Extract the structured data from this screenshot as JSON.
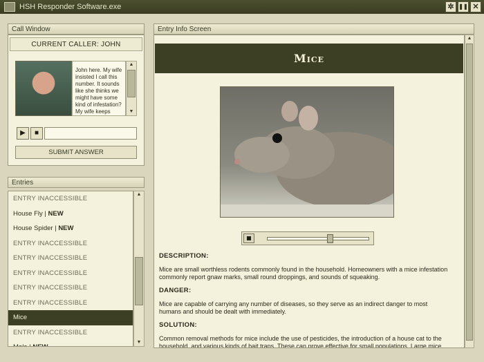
{
  "window": {
    "title": "HSH Responder Software.exe"
  },
  "window_buttons": [
    {
      "name": "settings-button",
      "glyph": "✲"
    },
    {
      "name": "pause-button",
      "glyph": "❚❚"
    },
    {
      "name": "close-button",
      "glyph": "✕"
    }
  ],
  "call_window": {
    "header": "Call Window",
    "current_caller": "CURRENT CALLER: JOHN",
    "transcript": "John here. My wife insisted I call this number. It sounds like she thinks we might have some kind of infestation? My wife keeps telling me about sounds of distr",
    "answer_value": "",
    "submit_label": "SUBMIT ANSWER"
  },
  "entries": {
    "header": "Entries",
    "items": [
      {
        "label": "ENTRY INACCESSIBLE",
        "new": "",
        "state": "inaccessible"
      },
      {
        "label": "House Fly | ",
        "new": "NEW",
        "state": "new"
      },
      {
        "label": "House Spider | ",
        "new": "NEW",
        "state": "new"
      },
      {
        "label": "ENTRY INACCESSIBLE",
        "new": "",
        "state": "inaccessible"
      },
      {
        "label": "ENTRY INACCESSIBLE",
        "new": "",
        "state": "inaccessible"
      },
      {
        "label": "ENTRY INACCESSIBLE",
        "new": "",
        "state": "inaccessible"
      },
      {
        "label": "ENTRY INACCESSIBLE",
        "new": "",
        "state": "inaccessible"
      },
      {
        "label": "ENTRY INACCESSIBLE",
        "new": "",
        "state": "inaccessible"
      },
      {
        "label": "Mice",
        "new": "",
        "state": "selected"
      },
      {
        "label": "ENTRY INACCESSIBLE",
        "new": "",
        "state": "inaccessible"
      },
      {
        "label": "Mole | ",
        "new": "NEW",
        "state": "new"
      }
    ]
  },
  "entry_info": {
    "header": "Entry Info Screen",
    "title": "Mice",
    "audio_progress": 0.62,
    "description_head": "DESCRIPTION:",
    "description": "Mice are small worthless rodents commonly found in the household. Homeowners with a mice infestation commonly report gnaw marks, small round droppings, and sounds of squeaking.",
    "danger_head": "DANGER:",
    "danger": "Mice are capable of carrying any number of diseases, so they serve as an indirect danger to most humans and should be dealt with immediately.",
    "solution_head": "SOLUTION:",
    "solution": "Common removal methods for mice include the use of pesticides, the introduction of a house cat to the household, and various kinds of bait traps. These can prove effective for small populations. Large mice"
  },
  "colors": {
    "accent_dark": "#3c3f24",
    "panel_bg": "#f4f1dc",
    "frame_bg": "#d9d6bd"
  }
}
